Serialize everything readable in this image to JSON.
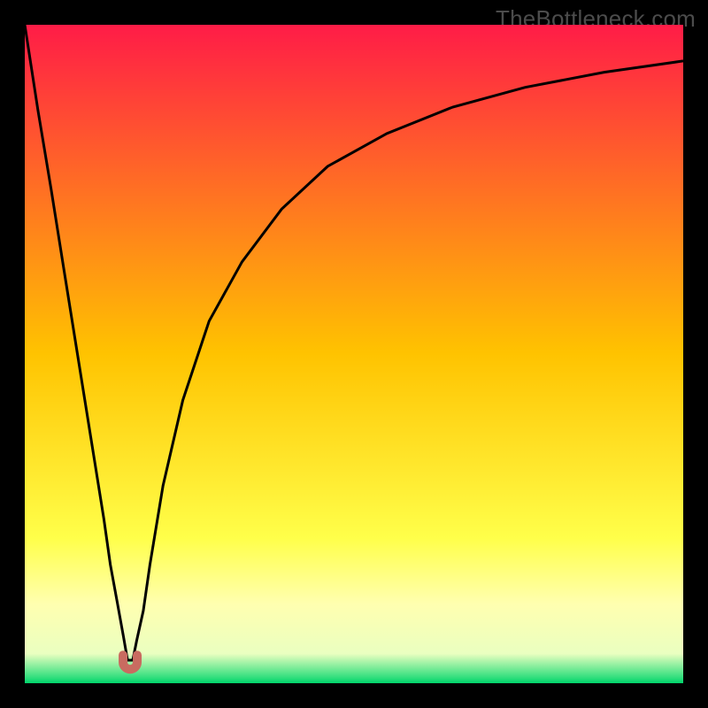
{
  "watermark": "TheBottleneck.com",
  "chart_data": {
    "type": "line",
    "title": "",
    "xlabel": "",
    "ylabel": "",
    "xlim": [
      0,
      100
    ],
    "ylim": [
      0,
      100
    ],
    "background_gradient": {
      "stops": [
        {
          "offset": 0.0,
          "color": "#ff1c47"
        },
        {
          "offset": 0.5,
          "color": "#ffc300"
        },
        {
          "offset": 0.78,
          "color": "#ffff4a"
        },
        {
          "offset": 0.88,
          "color": "#ffffb0"
        },
        {
          "offset": 0.955,
          "color": "#eaffc0"
        },
        {
          "offset": 0.99,
          "color": "#38e080"
        },
        {
          "offset": 1.0,
          "color": "#00d46a"
        }
      ]
    },
    "series": [
      {
        "name": "bottleneck-curve",
        "color": "#000000",
        "x": [
          0,
          2,
          4,
          6,
          8,
          10,
          12,
          13,
          14,
          15,
          15.6,
          16.4,
          17,
          18,
          19,
          21,
          24,
          28,
          33,
          39,
          46,
          55,
          65,
          76,
          88,
          100
        ],
        "y": [
          100,
          87,
          75,
          62.5,
          50,
          37.5,
          25,
          18,
          12.5,
          7,
          3.5,
          3.5,
          6.5,
          11,
          18,
          30,
          43,
          55,
          64,
          72,
          78.5,
          83.5,
          87.5,
          90.5,
          92.8,
          94.5
        ]
      }
    ],
    "marker": {
      "name": "optimal-point",
      "x": 16,
      "y": 3.2,
      "color": "#c96b60",
      "shape": "u"
    }
  }
}
